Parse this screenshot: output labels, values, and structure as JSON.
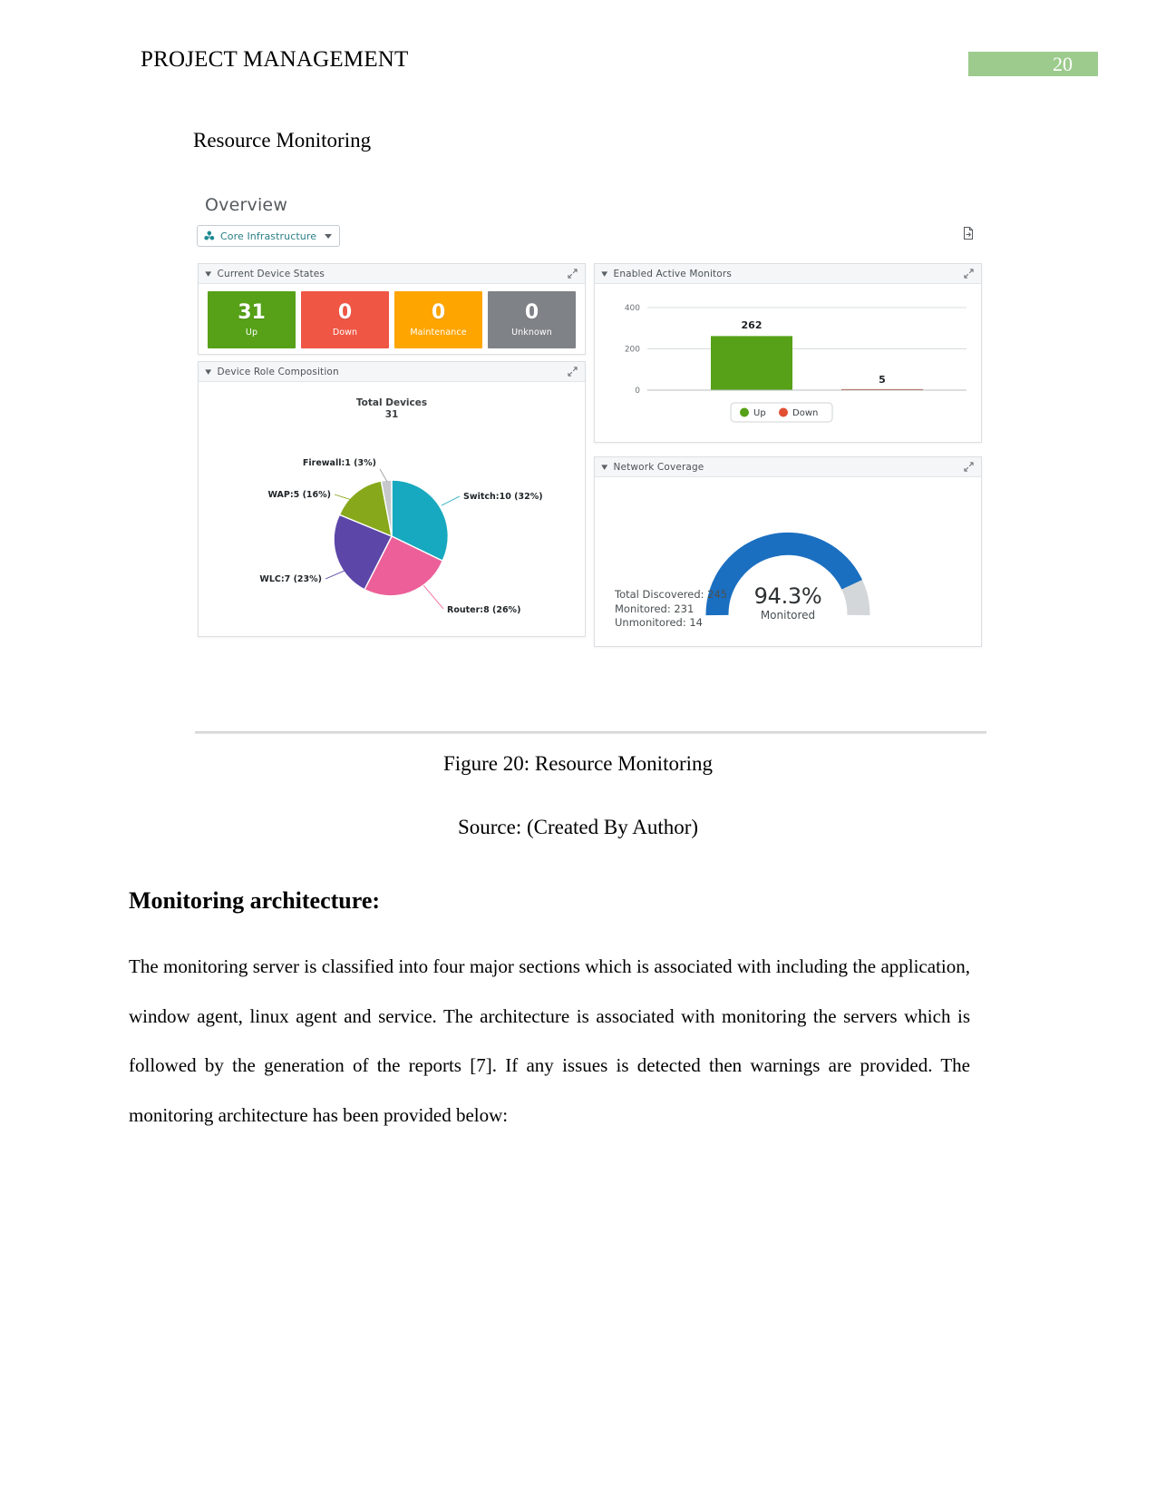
{
  "document": {
    "running_header": "PROJECT MANAGEMENT",
    "page_number": "20",
    "page_number_chip_color": "#9ccb8d",
    "section_label": "Resource Monitoring",
    "figure_caption": "Figure 20: Resource Monitoring",
    "figure_source": "Source: (Created By Author)",
    "body_heading": "Monitoring architecture:",
    "body_paragraph": "The monitoring server is classified into four major sections which is associated with including the application, window agent, linux agent and service. The architecture is associated with monitoring the servers which is followed by the generation of the reports [7]. If any issues is detected then warnings are provided. The monitoring architecture has been provided below:"
  },
  "dashboard": {
    "title": "Overview",
    "context_filter": {
      "label": "Core Infrastructure",
      "icon": "network-topology-icon",
      "caret": "chevron-down-icon"
    },
    "export_icon": "export-page-icon",
    "cards": {
      "device_states": {
        "title": "Current Device States",
        "collapse_icon": "chevron-down-icon",
        "expand_icon": "expand-arrows-icon",
        "tiles": [
          {
            "value": "31",
            "label": "Up",
            "color": "#56a117"
          },
          {
            "value": "0",
            "label": "Down",
            "color": "#ef5644"
          },
          {
            "value": "0",
            "label": "Maintenance",
            "color": "#ffa500"
          },
          {
            "value": "0",
            "label": "Unknown",
            "color": "#7f8286"
          }
        ]
      },
      "role_composition": {
        "title": "Device Role Composition",
        "collapse_icon": "chevron-down-icon",
        "expand_icon": "expand-arrows-icon",
        "total_label": "Total Devices",
        "total_value": "31"
      },
      "active_monitors": {
        "title": "Enabled Active Monitors",
        "collapse_icon": "chevron-down-icon",
        "expand_icon": "expand-arrows-icon"
      },
      "network_coverage": {
        "title": "Network Coverage",
        "collapse_icon": "chevron-down-icon",
        "expand_icon": "expand-arrows-icon",
        "percent": "94.3%",
        "percent_label": "Monitored",
        "stats": [
          "Total Discovered: 245",
          "Monitored: 231",
          "Unmonitored: 14"
        ],
        "arc_color": "#1b6fc0",
        "track_color": "#d4d7d9"
      }
    }
  },
  "chart_data": [
    {
      "id": "enabled-active-monitors",
      "type": "bar",
      "title": "Enabled Active Monitors",
      "categories": [
        "Up",
        "Down"
      ],
      "values": [
        262,
        5
      ],
      "data_labels": [
        "262",
        "5"
      ],
      "colors": [
        "#56a117",
        "#d9472b"
      ],
      "ylim": [
        0,
        400
      ],
      "yticks": [
        0,
        200,
        400
      ],
      "ytick_labels": [
        "0",
        "200",
        "400"
      ],
      "xlabel": "",
      "ylabel": "",
      "grid": true,
      "legend": {
        "position": "bottom",
        "entries": [
          "Up",
          "Down"
        ]
      }
    },
    {
      "id": "device-role-composition",
      "type": "pie",
      "title": "Device Role Composition",
      "center_title": "Total Devices",
      "center_value": "31",
      "total": 31,
      "labels": [
        "Switch",
        "Router",
        "WLC",
        "WAP",
        "Firewall"
      ],
      "values": [
        10,
        8,
        7,
        5,
        1
      ],
      "percents": [
        32,
        26,
        23,
        16,
        3
      ],
      "annotations": [
        "Switch:10 (32%)",
        "Router:8 (26%)",
        "WLC:7 (23%)",
        "WAP:5 (16%)",
        "Firewall:1 (3%)"
      ],
      "colors": [
        "#17a9bf",
        "#ec5f98",
        "#5c46a8",
        "#86a81a",
        "#c6c9cb"
      ]
    },
    {
      "id": "network-coverage",
      "type": "pie",
      "subtype": "gauge",
      "title": "Network Coverage",
      "labels": [
        "Monitored",
        "Unmonitored"
      ],
      "values": [
        231,
        14
      ],
      "total": 245,
      "percent": 94.3,
      "center_value": "94.3%",
      "center_label": "Monitored",
      "colors": [
        "#1b6fc0",
        "#d4d7d9"
      ]
    }
  ]
}
